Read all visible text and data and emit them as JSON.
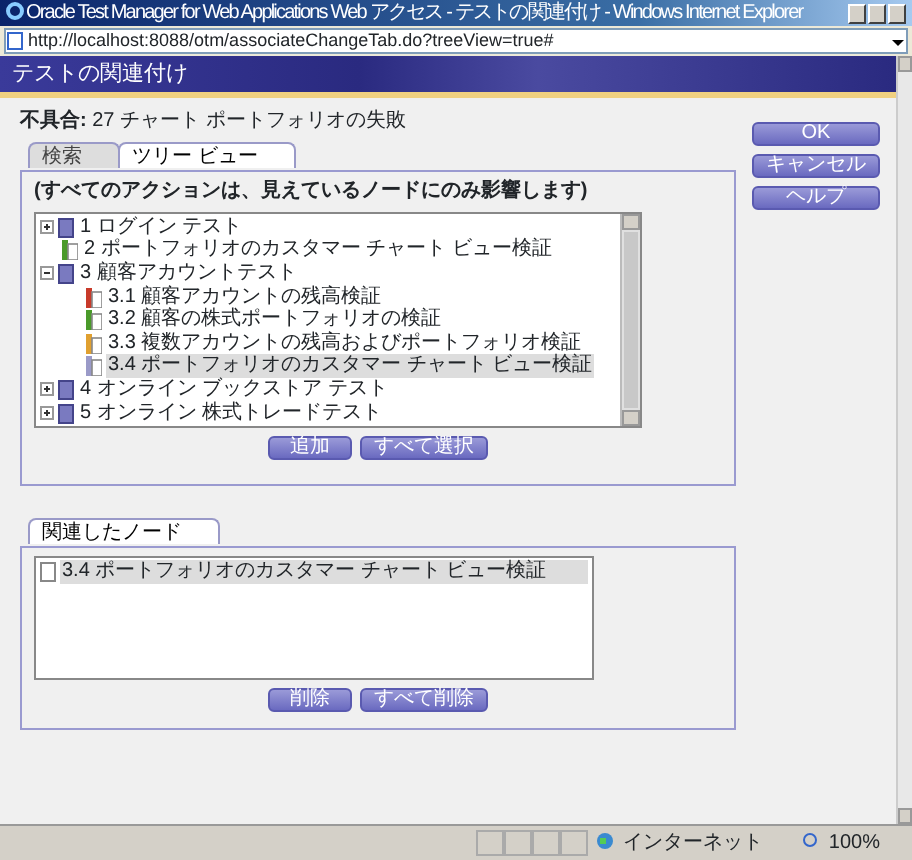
{
  "window": {
    "title": "Oracle Test Manager for Web Applications Web アクセス - テストの関連付け - Windows Internet Explorer",
    "address": "http://localhost:8088/otm/associateChangeTab.do?treeView=true#"
  },
  "page_title": "テストの関連付け",
  "defect": {
    "label": "不具合:",
    "value": "27 チャート ポートフォリオの失敗"
  },
  "tabs": [
    {
      "label": "検索",
      "selected": false
    },
    {
      "label": "ツリー ビュー",
      "selected": true
    }
  ],
  "tree_note": "(すべてのアクションは、見えているノードにのみ影響します)",
  "tree": [
    {
      "kind": "folder",
      "label": "1 ログイン テスト",
      "expanded": false,
      "selected": false
    },
    {
      "kind": "test",
      "label": "2 ポートフォリオのカスタマー チャート ビュー検証",
      "color": "#4a9a2a",
      "selected": false
    },
    {
      "kind": "folder",
      "label": "3 顧客アカウントテスト",
      "expanded": true,
      "selected": false,
      "children": [
        {
          "kind": "test",
          "label": "3.1 顧客アカウントの残高検証",
          "color": "#c83a2a",
          "selected": false
        },
        {
          "kind": "test",
          "label": "3.2 顧客の株式ポートフォリオの検証",
          "color": "#4a9a2a",
          "selected": false
        },
        {
          "kind": "test",
          "label": "3.3 複数アカウントの残高およびポートフォリオ検証",
          "color": "#e0a030",
          "selected": false
        },
        {
          "kind": "test",
          "label": "3.4 ポートフォリオのカスタマー チャート ビュー検証",
          "color": "#9a9ac8",
          "selected": true
        }
      ]
    },
    {
      "kind": "folder",
      "label": "4 オンライン ブックストア テスト",
      "expanded": false,
      "selected": false
    },
    {
      "kind": "folder",
      "label": "5 オンライン 株式トレードテスト",
      "expanded": false,
      "selected": false
    }
  ],
  "tree_buttons": [
    "追加",
    "すべて選択"
  ],
  "associated_tab": "関連したノード",
  "associated": [
    {
      "label": "3.4 ポートフォリオのカスタマー チャート ビュー検証",
      "selected": true
    }
  ],
  "associated_buttons": [
    "削除",
    "すべて削除"
  ],
  "side_buttons": [
    "OK",
    "キャンセル",
    "ヘルプ"
  ],
  "status_bar": {
    "zone": "インターネット",
    "zoom": "100%"
  }
}
